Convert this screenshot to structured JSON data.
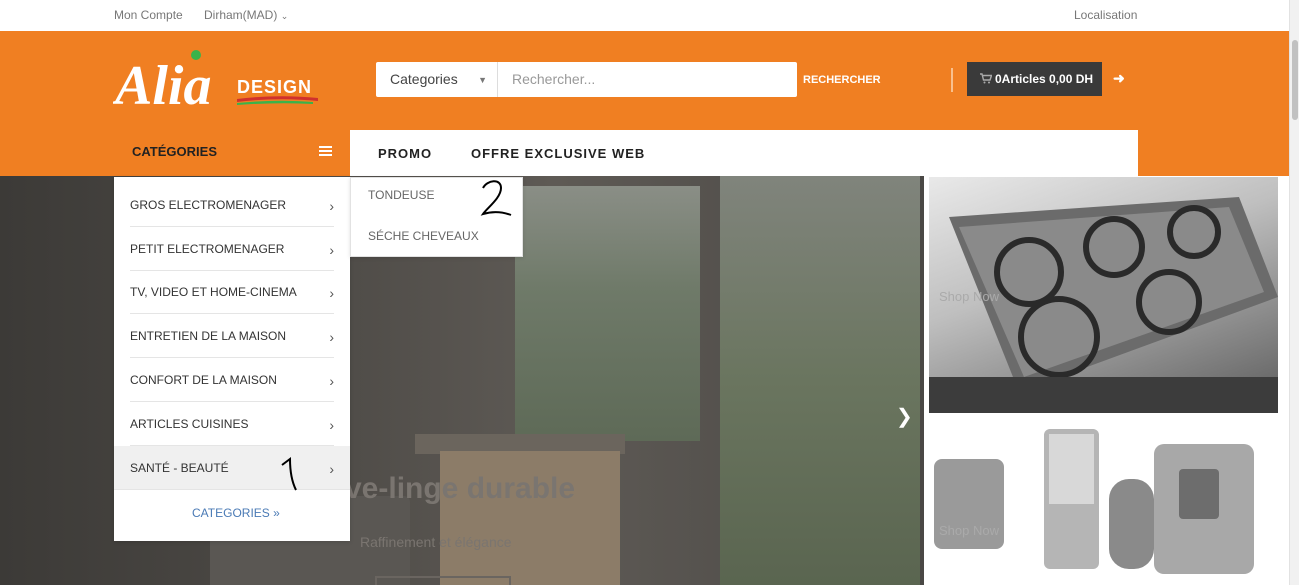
{
  "topbar": {
    "account": "Mon Compte",
    "currency": "Dirham(MAD)",
    "location": "Localisation"
  },
  "header": {
    "logo_text": "Alia",
    "logo_sub": "DESIGN",
    "search": {
      "category": "Categories",
      "placeholder": "Rechercher...",
      "button": "RECHERCHER"
    },
    "cart": {
      "label": "0Articles 0,00 DH"
    }
  },
  "nav": {
    "categories_label": "CATÉGORIES",
    "items": [
      "PROMO",
      "OFFRE EXCLUSIVE WEB"
    ]
  },
  "categories_menu": {
    "items": [
      "GROS ELECTROMENAGER",
      "PETIT ELECTROMENAGER",
      "TV, VIDEO ET HOME-CINEMA",
      "ENTRETIEN DE LA MAISON",
      "CONFORT DE LA MAISON",
      "ARTICLES CUISINES",
      "SANTÉ - BEAUTÉ"
    ],
    "active_index": 6,
    "more_label": "CATEGORIES"
  },
  "submenu": {
    "items": [
      "TONDEUSE",
      "SÉCHE CHEVEAUX"
    ]
  },
  "hero": {
    "title": "ve-linge durable",
    "subtitle": "Raffinement et élégance"
  },
  "banners": {
    "shop_now_1": "Shop Now",
    "shop_now_2": "Shop Now"
  },
  "annotations": {
    "mark_1": "1",
    "mark_2": "2"
  },
  "colors": {
    "brand_orange": "#f07f22",
    "dark": "#3a3a3a"
  }
}
